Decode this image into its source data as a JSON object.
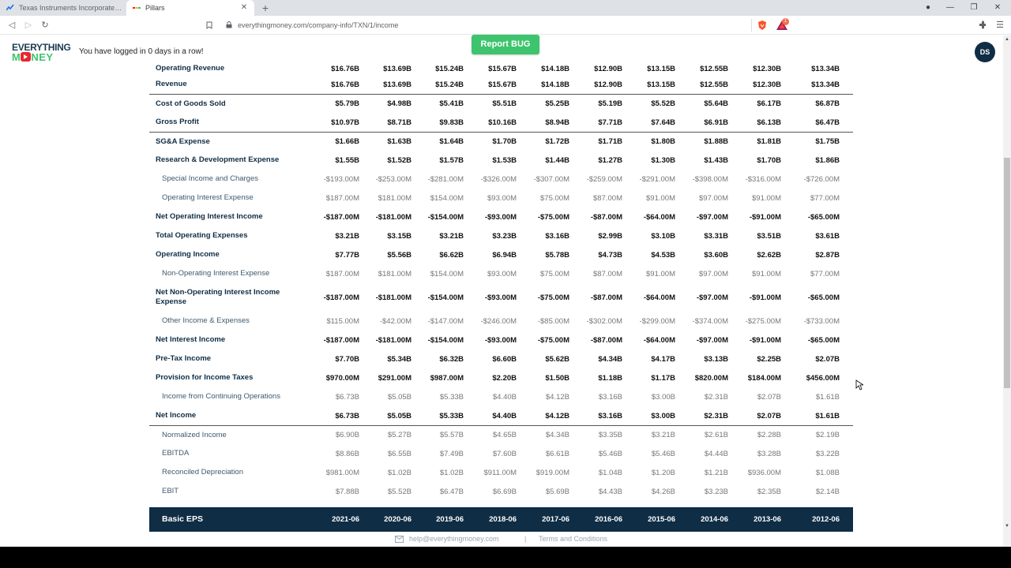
{
  "browser": {
    "tabs": [
      {
        "title": "Texas Instruments Incorporated Comm",
        "active": false
      },
      {
        "title": "Pillars",
        "active": true
      }
    ],
    "url": "everythingmoney.com/company-info/TXN/1/income",
    "bat_badge": "1"
  },
  "site": {
    "logo_top": "EVERYTHING",
    "logo_bottom": "MONEY",
    "streak_text": "You have logged in 0 days in a row!",
    "report_button": "Report BUG",
    "avatar_initials": "DS"
  },
  "table": {
    "columns": [
      "2021-06",
      "2020-06",
      "2019-06",
      "2018-06",
      "2017-06",
      "2016-06",
      "2015-06",
      "2014-06",
      "2013-06",
      "2012-06"
    ],
    "rows": [
      {
        "label": "Operating Revenue",
        "style": "bold",
        "cut": true,
        "values": [
          "$16.76B",
          "$13.69B",
          "$15.24B",
          "$15.67B",
          "$14.18B",
          "$12.90B",
          "$13.15B",
          "$12.55B",
          "$12.30B",
          "$13.34B"
        ]
      },
      {
        "label": "Revenue",
        "style": "bold",
        "values": [
          "$16.76B",
          "$13.69B",
          "$15.24B",
          "$15.67B",
          "$14.18B",
          "$12.90B",
          "$13.15B",
          "$12.55B",
          "$12.30B",
          "$13.34B"
        ]
      },
      {
        "label": "Cost of Goods Sold",
        "style": "bold",
        "sep": true,
        "values": [
          "$5.79B",
          "$4.98B",
          "$5.41B",
          "$5.51B",
          "$5.25B",
          "$5.19B",
          "$5.52B",
          "$5.64B",
          "$6.17B",
          "$6.87B"
        ]
      },
      {
        "label": "Gross Profit",
        "style": "bold",
        "values": [
          "$10.97B",
          "$8.71B",
          "$9.83B",
          "$10.16B",
          "$8.94B",
          "$7.71B",
          "$7.64B",
          "$6.91B",
          "$6.13B",
          "$6.47B"
        ]
      },
      {
        "label": "SG&A Expense",
        "style": "bold",
        "sep": true,
        "values": [
          "$1.66B",
          "$1.63B",
          "$1.64B",
          "$1.70B",
          "$1.72B",
          "$1.71B",
          "$1.80B",
          "$1.88B",
          "$1.81B",
          "$1.75B"
        ]
      },
      {
        "label": "Research & Development Expense",
        "style": "bold",
        "values": [
          "$1.55B",
          "$1.52B",
          "$1.57B",
          "$1.53B",
          "$1.44B",
          "$1.27B",
          "$1.30B",
          "$1.43B",
          "$1.70B",
          "$1.86B"
        ]
      },
      {
        "label": "Special Income and Charges",
        "style": "sub",
        "values": [
          "-$193.00M",
          "-$253.00M",
          "-$281.00M",
          "-$326.00M",
          "-$307.00M",
          "-$259.00M",
          "-$291.00M",
          "-$398.00M",
          "-$316.00M",
          "-$726.00M"
        ]
      },
      {
        "label": "Operating Interest Expense",
        "style": "sub",
        "values": [
          "$187.00M",
          "$181.00M",
          "$154.00M",
          "$93.00M",
          "$75.00M",
          "$87.00M",
          "$91.00M",
          "$97.00M",
          "$91.00M",
          "$77.00M"
        ]
      },
      {
        "label": "Net Operating Interest Income",
        "style": "bold",
        "values": [
          "-$187.00M",
          "-$181.00M",
          "-$154.00M",
          "-$93.00M",
          "-$75.00M",
          "-$87.00M",
          "-$64.00M",
          "-$97.00M",
          "-$91.00M",
          "-$65.00M"
        ]
      },
      {
        "label": "Total Operating Expenses",
        "style": "bold",
        "values": [
          "$3.21B",
          "$3.15B",
          "$3.21B",
          "$3.23B",
          "$3.16B",
          "$2.99B",
          "$3.10B",
          "$3.31B",
          "$3.51B",
          "$3.61B"
        ]
      },
      {
        "label": "Operating Income",
        "style": "bold",
        "values": [
          "$7.77B",
          "$5.56B",
          "$6.62B",
          "$6.94B",
          "$5.78B",
          "$4.73B",
          "$4.53B",
          "$3.60B",
          "$2.62B",
          "$2.87B"
        ]
      },
      {
        "label": "Non-Operating Interest Expense",
        "style": "sub",
        "values": [
          "$187.00M",
          "$181.00M",
          "$154.00M",
          "$93.00M",
          "$75.00M",
          "$87.00M",
          "$91.00M",
          "$97.00M",
          "$91.00M",
          "$77.00M"
        ]
      },
      {
        "label": "Net Non-Operating Interest Income Expense",
        "style": "bold",
        "tall": true,
        "values": [
          "-$187.00M",
          "-$181.00M",
          "-$154.00M",
          "-$93.00M",
          "-$75.00M",
          "-$87.00M",
          "-$64.00M",
          "-$97.00M",
          "-$91.00M",
          "-$65.00M"
        ]
      },
      {
        "label": "Other Income & Expenses",
        "style": "sub",
        "values": [
          "$115.00M",
          "-$42.00M",
          "-$147.00M",
          "-$246.00M",
          "-$85.00M",
          "-$302.00M",
          "-$299.00M",
          "-$374.00M",
          "-$275.00M",
          "-$733.00M"
        ]
      },
      {
        "label": "Net Interest Income",
        "style": "bold",
        "values": [
          "-$187.00M",
          "-$181.00M",
          "-$154.00M",
          "-$93.00M",
          "-$75.00M",
          "-$87.00M",
          "-$64.00M",
          "-$97.00M",
          "-$91.00M",
          "-$65.00M"
        ]
      },
      {
        "label": "Pre-Tax Income",
        "style": "bold",
        "values": [
          "$7.70B",
          "$5.34B",
          "$6.32B",
          "$6.60B",
          "$5.62B",
          "$4.34B",
          "$4.17B",
          "$3.13B",
          "$2.25B",
          "$2.07B"
        ]
      },
      {
        "label": "Provision for Income Taxes",
        "style": "bold",
        "values": [
          "$970.00M",
          "$291.00M",
          "$987.00M",
          "$2.20B",
          "$1.50B",
          "$1.18B",
          "$1.17B",
          "$820.00M",
          "$184.00M",
          "$456.00M"
        ]
      },
      {
        "label": "Income from Continuing Operations",
        "style": "sub",
        "values": [
          "$6.73B",
          "$5.05B",
          "$5.33B",
          "$4.40B",
          "$4.12B",
          "$3.16B",
          "$3.00B",
          "$2.31B",
          "$2.07B",
          "$1.61B"
        ]
      },
      {
        "label": "Net Income",
        "style": "bold",
        "values": [
          "$6.73B",
          "$5.05B",
          "$5.33B",
          "$4.40B",
          "$4.12B",
          "$3.16B",
          "$3.00B",
          "$2.31B",
          "$2.07B",
          "$1.61B"
        ]
      },
      {
        "label": "Normalized Income",
        "style": "sub",
        "sep": true,
        "values": [
          "$6.90B",
          "$5.27B",
          "$5.57B",
          "$4.65B",
          "$4.34B",
          "$3.35B",
          "$3.21B",
          "$2.61B",
          "$2.28B",
          "$2.19B"
        ]
      },
      {
        "label": "EBITDA",
        "style": "sub",
        "values": [
          "$8.86B",
          "$6.55B",
          "$7.49B",
          "$7.60B",
          "$6.61B",
          "$5.46B",
          "$5.46B",
          "$4.44B",
          "$3.28B",
          "$3.22B"
        ]
      },
      {
        "label": "Reconciled Depreciation",
        "style": "sub",
        "values": [
          "$981.00M",
          "$1.02B",
          "$1.02B",
          "$911.00M",
          "$919.00M",
          "$1.04B",
          "$1.20B",
          "$1.21B",
          "$936.00M",
          "$1.08B"
        ]
      },
      {
        "label": "EBIT",
        "style": "sub",
        "values": [
          "$7.88B",
          "$5.52B",
          "$6.47B",
          "$6.69B",
          "$5.69B",
          "$4.43B",
          "$4.26B",
          "$3.23B",
          "$2.35B",
          "$2.14B"
        ]
      }
    ],
    "basic_eps_label": "Basic EPS"
  },
  "footer": {
    "email": "help@everythingmoney.com",
    "separator": "|",
    "terms": "Terms and Conditions"
  },
  "colors": {
    "navy": "#0f2d44",
    "report_green": "#3ec46d",
    "logo_red": "#e8262d",
    "logo_green": "#3ec46d"
  }
}
